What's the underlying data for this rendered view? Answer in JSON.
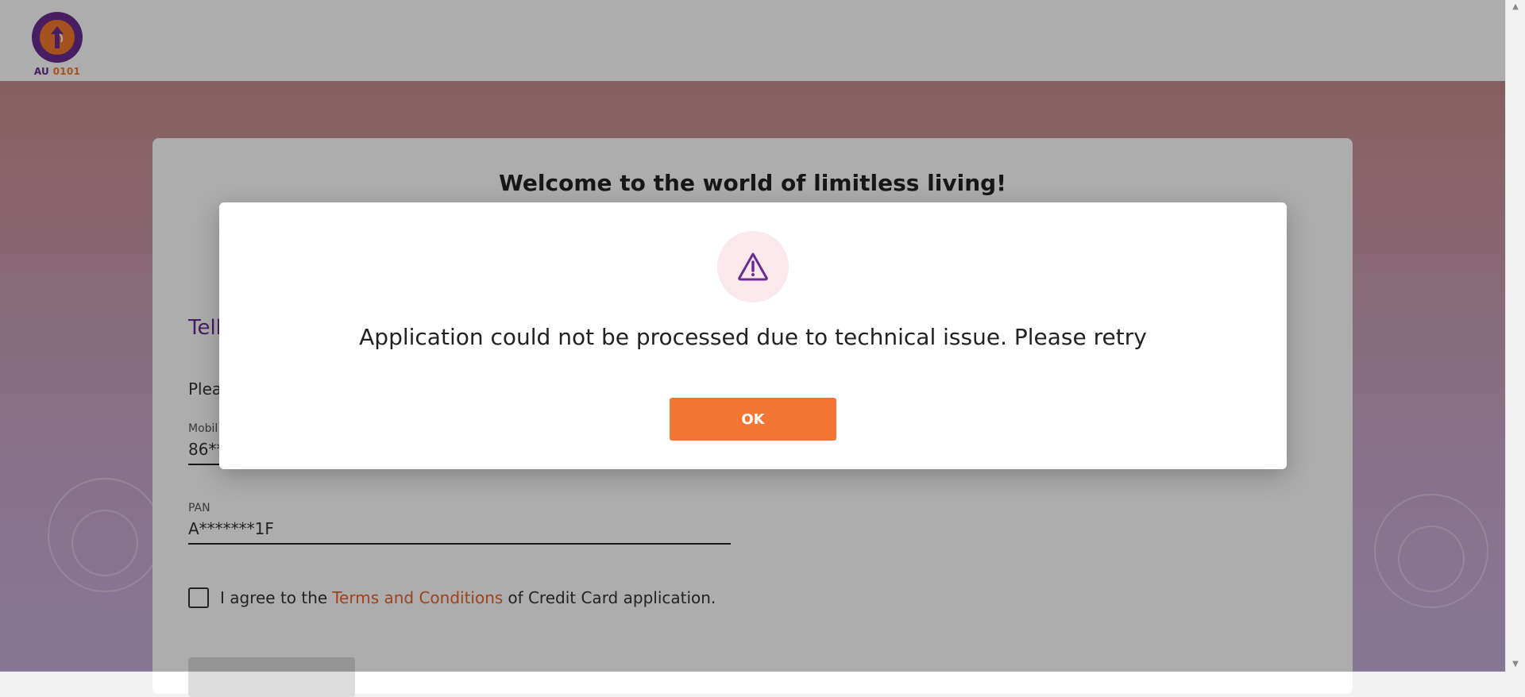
{
  "brand": {
    "logo_text_left": "AU",
    "logo_text_right": "0101",
    "primary_color": "#6b2c91",
    "accent_color": "#f47634"
  },
  "page": {
    "welcome_title": "Welcome to the world of limitless living!",
    "section_title": "Tell",
    "instruction": "Plea",
    "mobile_label": "Mobil",
    "mobile_value": "86**",
    "pan_label": "PAN",
    "pan_value": "A*******1F",
    "agree_prefix": "I agree to the",
    "terms_link": "Terms and Conditions",
    "agree_suffix": "of Credit Card application."
  },
  "modal": {
    "icon": "warning-triangle-icon",
    "message": "Application could not be processed due to technical issue. Please retry",
    "ok_label": "OK"
  }
}
